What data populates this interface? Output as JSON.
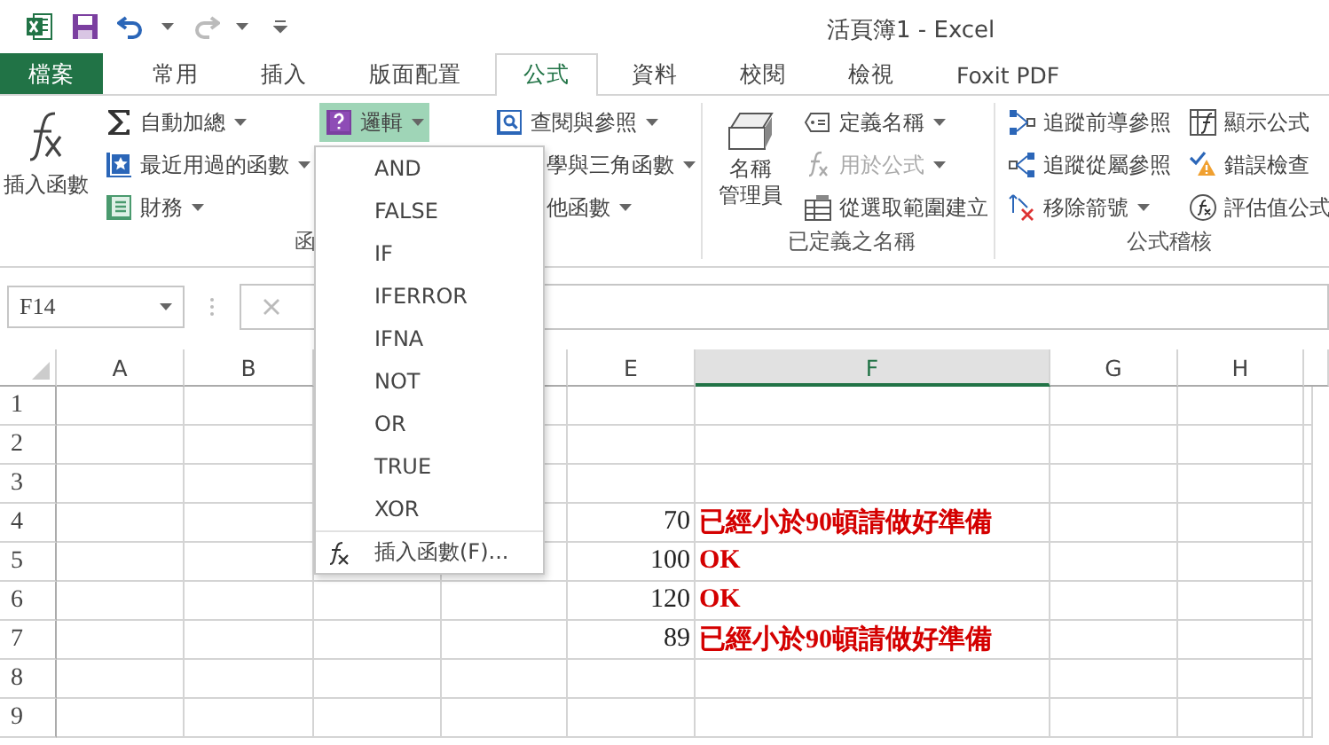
{
  "title_bar": {
    "title": "活頁簿1 - Excel"
  },
  "tabs": [
    {
      "label": "檔案",
      "kind": "file",
      "selected": false
    },
    {
      "label": "常用",
      "kind": "tab",
      "selected": false
    },
    {
      "label": "插入",
      "kind": "tab",
      "selected": false
    },
    {
      "label": "版面配置",
      "kind": "tab",
      "selected": false
    },
    {
      "label": "公式",
      "kind": "tab",
      "selected": true
    },
    {
      "label": "資料",
      "kind": "tab",
      "selected": false
    },
    {
      "label": "校閱",
      "kind": "tab",
      "selected": false
    },
    {
      "label": "檢視",
      "kind": "tab",
      "selected": false
    },
    {
      "label": "Foxit PDF",
      "kind": "tab",
      "selected": false
    }
  ],
  "function_library": {
    "insert_function": "插入函數",
    "group_label": "函",
    "column_1": [
      {
        "label": "自動加總",
        "dropdown": true,
        "expanded": false
      },
      {
        "label": "最近用過的函數",
        "dropdown": true,
        "expanded": false
      },
      {
        "label": "財務",
        "dropdown": true,
        "expanded": false
      }
    ],
    "column_2": [
      {
        "label": "邏輯",
        "dropdown": true,
        "expanded": true
      }
    ],
    "column_3": [
      {
        "label": "查閱與參照",
        "dropdown": true
      },
      {
        "label": "學與三角函數",
        "dropdown": true
      },
      {
        "label": "他函數",
        "dropdown": true
      }
    ]
  },
  "defined_names": {
    "name_manager": [
      "名稱",
      "管理員"
    ],
    "group_label": "已定義之名稱",
    "items": [
      {
        "label": "定義名稱",
        "dropdown": true,
        "disabled": false
      },
      {
        "label": "用於公式",
        "dropdown": true,
        "disabled": true
      },
      {
        "label": "從選取範圍建立",
        "dropdown": false,
        "disabled": false
      }
    ]
  },
  "formula_auditing": {
    "group_label": "公式稽核",
    "column_1": [
      {
        "label": "追蹤前導參照",
        "dropdown": false
      },
      {
        "label": "追蹤從屬參照",
        "dropdown": false
      },
      {
        "label": "移除箭號",
        "dropdown": true
      }
    ],
    "column_2": [
      {
        "label": "顯示公式"
      },
      {
        "label": "錯誤檢查"
      },
      {
        "label": "評估值公式"
      }
    ]
  },
  "logic_menu": {
    "items": [
      "AND",
      "FALSE",
      "IF",
      "IFERROR",
      "IFNA",
      "NOT",
      "OR",
      "TRUE",
      "XOR"
    ],
    "insert_function": "插入函數(F)..."
  },
  "formula_bar": {
    "name_box": "F14"
  },
  "sheet": {
    "columns": [
      {
        "label": "A",
        "selected": false
      },
      {
        "label": "B",
        "selected": false
      },
      {},
      {
        "selected": false
      },
      {
        "label": "E",
        "selected": false
      },
      {
        "label": "F",
        "selected": true
      },
      {
        "label": "G",
        "selected": false
      },
      {
        "label": "H",
        "selected": false
      }
    ],
    "rows": [
      {
        "number": "1"
      },
      {
        "number": "2"
      },
      {
        "number": "3"
      },
      {
        "number": "4",
        "e": "70",
        "f": "已經小於90頓請做好準備"
      },
      {
        "number": "5",
        "e": "100",
        "f": "OK"
      },
      {
        "number": "6",
        "e": "120",
        "f": "OK"
      },
      {
        "number": "7",
        "e": "89",
        "f": "已經小於90頓請做好準備"
      },
      {
        "number": "8"
      },
      {
        "number": "9"
      }
    ]
  }
}
